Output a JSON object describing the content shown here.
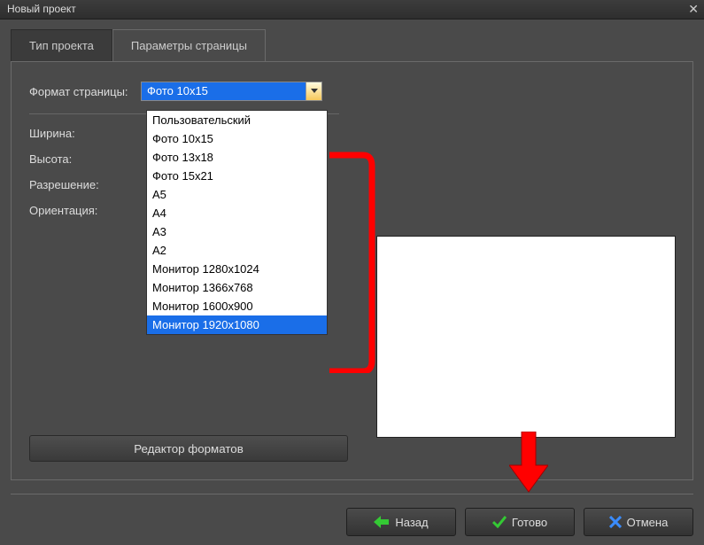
{
  "window": {
    "title": "Новый проект"
  },
  "tabs": {
    "project_type": "Тип проекта",
    "page_params": "Параметры страницы"
  },
  "form": {
    "page_format_label": "Формат страницы:",
    "width_label": "Ширина:",
    "height_label": "Высота:",
    "resolution_label": "Разрешение:",
    "orientation_label": "Ориентация:"
  },
  "combo": {
    "selected": "Фото 10x15",
    "options": [
      "Пользовательский",
      "Фото 10x15",
      "Фото 13x18",
      "Фото 15x21",
      "A5",
      "A4",
      "A3",
      "A2",
      "Монитор 1280x1024",
      "Монитор 1366x768",
      "Монитор 1600x900",
      "Монитор 1920x1080"
    ],
    "highlighted_index": 11
  },
  "buttons": {
    "editor": "Редактор форматов",
    "back": "Назад",
    "done": "Готово",
    "cancel": "Отмена"
  },
  "colors": {
    "annotation": "#ff0000",
    "highlight": "#1a6ee8"
  }
}
